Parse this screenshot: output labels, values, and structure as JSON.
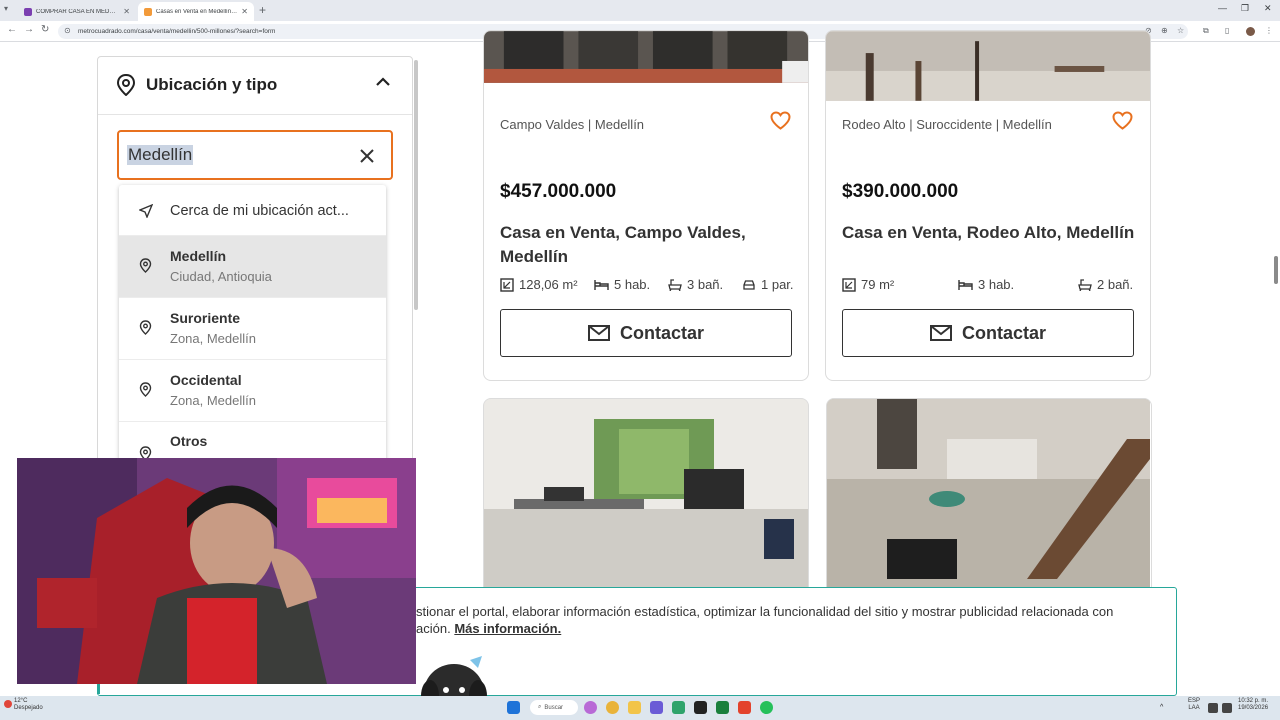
{
  "browser": {
    "tabs": [
      {
        "title": "COMPRAR CASA EN MEDELLIN",
        "active": false
      },
      {
        "title": "Casas en Venta en Medellín - V",
        "active": true
      }
    ],
    "url": "metrocuadrado.com/casa/venta/medellin/500-millones/?search=form"
  },
  "filter": {
    "section_title": "Ubicación y tipo",
    "search_value": "Medellín",
    "suggestions": [
      {
        "type": "nearby",
        "label": "Cerca de mi ubicación act..."
      },
      {
        "label": "Medellín",
        "sub": "Ciudad, Antioquia",
        "selected": true
      },
      {
        "label": "Suroriente",
        "sub": "Zona, Medellín"
      },
      {
        "label": "Occidental",
        "sub": "Zona, Medellín"
      },
      {
        "label": "Otros",
        "sub": ""
      }
    ]
  },
  "listings": [
    {
      "location": "Campo Valdes | Medellín",
      "price": "$457.000.000",
      "title": "Casa en Venta, Campo Valdes, Medellín",
      "area": "128,06 m²",
      "rooms": "5 hab.",
      "baths": "3 bañ.",
      "parking": "1 par.",
      "cta": "Contactar"
    },
    {
      "location": "Rodeo Alto | Suroccidente | Medellín",
      "price": "$390.000.000",
      "title": "Casa en Venta, Rodeo Alto, Medellín",
      "area": "79 m²",
      "rooms": "3 hab.",
      "baths": "2 bañ.",
      "cta": "Contactar"
    }
  ],
  "cookie": {
    "line1": "stionar el portal, elaborar información estadística, optimizar la funcionalidad del sitio y mostrar publicidad relacionada con",
    "line2": "ación.",
    "link": "Más información."
  },
  "taskbar": {
    "temp": "12°C",
    "weather": "Despejado",
    "search": "Buscar",
    "lang1": "ESP",
    "lang2": "LAA",
    "time": "10:32 p. m.",
    "date": "19/03/2026"
  },
  "colors": {
    "accent": "#e8711f",
    "banner_border": "#27a79a"
  }
}
